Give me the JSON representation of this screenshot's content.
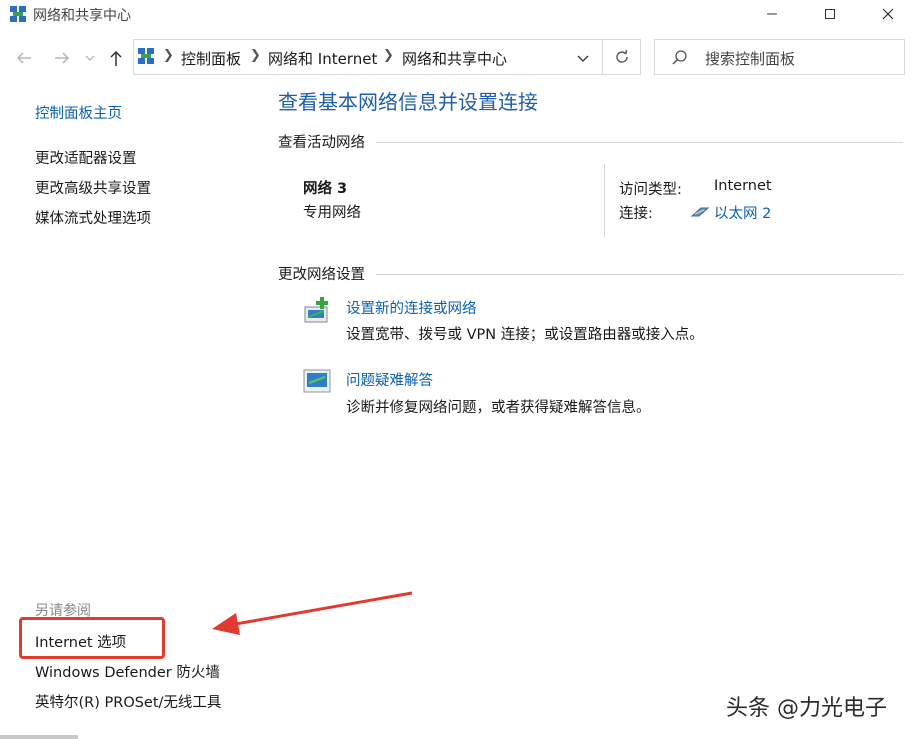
{
  "window": {
    "title": "网络和共享中心",
    "minimize_icon": "minimize-icon",
    "maximize_icon": "maximize-icon",
    "close_icon": "close-icon"
  },
  "nav": {
    "back_icon": "back-arrow-icon",
    "forward_icon": "forward-arrow-icon",
    "recent_icon": "chevron-down-icon",
    "up_icon": "up-arrow-icon",
    "breadcrumbs": [
      "控制面板",
      "网络和 Internet",
      "网络和共享中心"
    ],
    "refresh_icon": "refresh-icon",
    "search_placeholder": "搜索控制面板"
  },
  "sidebar": {
    "home_link": "控制面板主页",
    "links": [
      "更改适配器设置",
      "更改高级共享设置",
      "媒体流式处理选项"
    ],
    "see_also_heading": "另请参阅",
    "see_also": [
      "Internet 选项",
      "Windows Defender 防火墙",
      "英特尔(R) PROSet/无线工具"
    ]
  },
  "main": {
    "title": "查看基本网络信息并设置连接",
    "active_networks_heading": "查看活动网络",
    "network": {
      "name": "网络 3",
      "type": "专用网络",
      "access_type_label": "访问类型:",
      "access_type_value": "Internet",
      "connection_label": "连接:",
      "connection_value": "以太网 2"
    },
    "change_settings_heading": "更改网络设置",
    "tasks": [
      {
        "title": "设置新的连接或网络",
        "desc": "设置宽带、拨号或 VPN 连接；或设置路由器或接入点。"
      },
      {
        "title": "问题疑难解答",
        "desc": "诊断并修复网络问题，或者获得疑难解答信息。"
      }
    ]
  },
  "watermark": "头条 @力光电子",
  "colors": {
    "link": "#0b61b0",
    "title": "#1f5ea8",
    "annotation": "#e33a30"
  }
}
